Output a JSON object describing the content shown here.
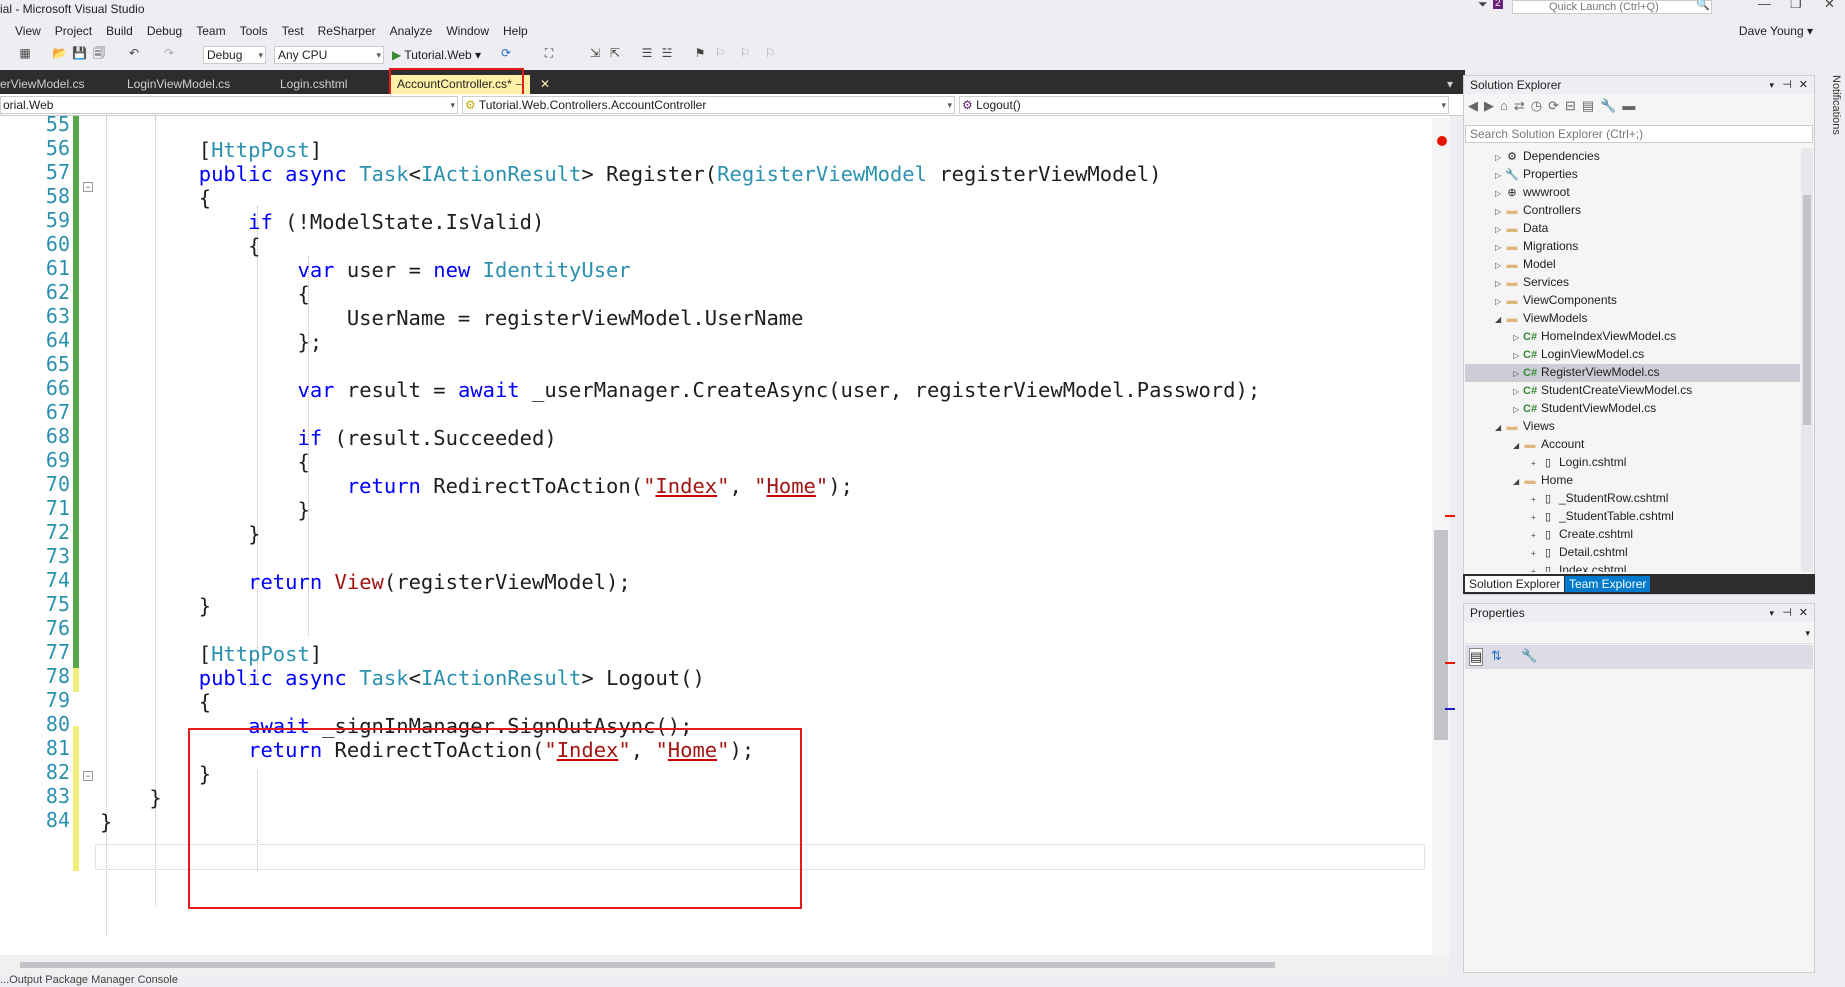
{
  "window": {
    "title": "ial - Microsoft Visual Studio",
    "quick_launch_placeholder": "Quick Launch (Ctrl+Q)",
    "notification_badge": "2",
    "user": "Dave Young"
  },
  "menu": [
    "View",
    "Project",
    "Build",
    "Debug",
    "Team",
    "Tools",
    "Test",
    "ReSharper",
    "Analyze",
    "Window",
    "Help"
  ],
  "toolbar": {
    "config": "Debug",
    "platform": "Any CPU",
    "run_target": "Tutorial.Web"
  },
  "tabs": [
    {
      "label": "erViewModel.cs",
      "active": false
    },
    {
      "label": "LoginViewModel.cs",
      "active": false
    },
    {
      "label": "Login.cshtml",
      "active": false
    },
    {
      "label": "AccountController.cs*",
      "active": true
    }
  ],
  "tab_close_glyph": "✕",
  "tab_pin_glyph": "⊣",
  "navbar": {
    "project": "orial.Web",
    "class": "Tutorial.Web.Controllers.AccountController",
    "member": "Logout()"
  },
  "editor": {
    "line_numbers": [
      "55",
      "56",
      "57",
      "58",
      "59",
      "60",
      "61",
      "62",
      "63",
      "64",
      "65",
      "66",
      "67",
      "68",
      "69",
      "70",
      "71",
      "72",
      "73",
      "74",
      "75",
      "76",
      "77",
      "78",
      "79",
      "80",
      "81",
      "82",
      "83",
      "84"
    ],
    "lines": [
      "",
      "        [HttpPost]",
      "        public async Task<IActionResult> Register(RegisterViewModel registerViewModel)",
      "        {",
      "            if (!ModelState.IsValid)",
      "            {",
      "                var user = new IdentityUser",
      "                {",
      "                    UserName = registerViewModel.UserName",
      "                };",
      "",
      "                var result = await _userManager.CreateAsync(user, registerViewModel.Password);",
      "",
      "                if (result.Succeeded)",
      "                {",
      "                    return RedirectToAction(\"Index\", \"Home\");",
      "                }",
      "            }",
      "",
      "            return View(registerViewModel);",
      "        }",
      "",
      "        [HttpPost]",
      "        public async Task<IActionResult> Logout()",
      "        {",
      "            await _signInManager.SignOutAsync();",
      "            return RedirectToAction(\"Index\", \"Home\");",
      "        }",
      "    }",
      "}"
    ]
  },
  "solution_explorer": {
    "title": "Solution Explorer",
    "search_placeholder": "Search Solution Explorer (Ctrl+;)",
    "items": [
      {
        "label": "Dependencies",
        "depth": 0,
        "icon": "dependencies-icon",
        "expanded": false
      },
      {
        "label": "Properties",
        "depth": 0,
        "icon": "wrench-icon",
        "expanded": false
      },
      {
        "label": "wwwroot",
        "depth": 0,
        "icon": "globe-icon",
        "expanded": false
      },
      {
        "label": "Controllers",
        "depth": 0,
        "icon": "folder-icon",
        "expanded": false
      },
      {
        "label": "Data",
        "depth": 0,
        "icon": "folder-icon",
        "expanded": false
      },
      {
        "label": "Migrations",
        "depth": 0,
        "icon": "folder-icon",
        "expanded": false
      },
      {
        "label": "Model",
        "depth": 0,
        "icon": "folder-icon",
        "expanded": false
      },
      {
        "label": "Services",
        "depth": 0,
        "icon": "folder-icon",
        "expanded": false
      },
      {
        "label": "ViewComponents",
        "depth": 0,
        "icon": "folder-icon",
        "expanded": false
      },
      {
        "label": "ViewModels",
        "depth": 0,
        "icon": "folder-icon",
        "expanded": true
      },
      {
        "label": "HomeIndexViewModel.cs",
        "depth": 1,
        "icon": "csharp-icon",
        "expanded": false
      },
      {
        "label": "LoginViewModel.cs",
        "depth": 1,
        "icon": "csharp-icon",
        "expanded": false
      },
      {
        "label": "RegisterViewModel.cs",
        "depth": 1,
        "icon": "csharp-icon",
        "expanded": false,
        "selected": true
      },
      {
        "label": "StudentCreateViewModel.cs",
        "depth": 1,
        "icon": "csharp-icon",
        "expanded": false
      },
      {
        "label": "StudentViewModel.cs",
        "depth": 1,
        "icon": "csharp-icon",
        "expanded": false
      },
      {
        "label": "Views",
        "depth": 0,
        "icon": "folder-icon",
        "expanded": true
      },
      {
        "label": "Account",
        "depth": 1,
        "icon": "folder-icon",
        "expanded": true
      },
      {
        "label": "Login.cshtml",
        "depth": 2,
        "icon": "razor-icon",
        "leaf": true
      },
      {
        "label": "Home",
        "depth": 1,
        "icon": "folder-icon",
        "expanded": true
      },
      {
        "label": "_StudentRow.cshtml",
        "depth": 2,
        "icon": "razor-icon",
        "leaf": true
      },
      {
        "label": "_StudentTable.cshtml",
        "depth": 2,
        "icon": "razor-icon",
        "leaf": true
      },
      {
        "label": "Create.cshtml",
        "depth": 2,
        "icon": "razor-icon",
        "leaf": true
      },
      {
        "label": "Detail.cshtml",
        "depth": 2,
        "icon": "razor-icon",
        "leaf": true
      },
      {
        "label": "Index.cshtml",
        "depth": 2,
        "icon": "razor-icon",
        "leaf": true
      }
    ],
    "tabs": [
      "Solution Explorer",
      "Team Explorer"
    ]
  },
  "properties": {
    "title": "Properties"
  },
  "notifications_label": "Notifications",
  "statusbar_text": "...Output  Package Manager Console"
}
